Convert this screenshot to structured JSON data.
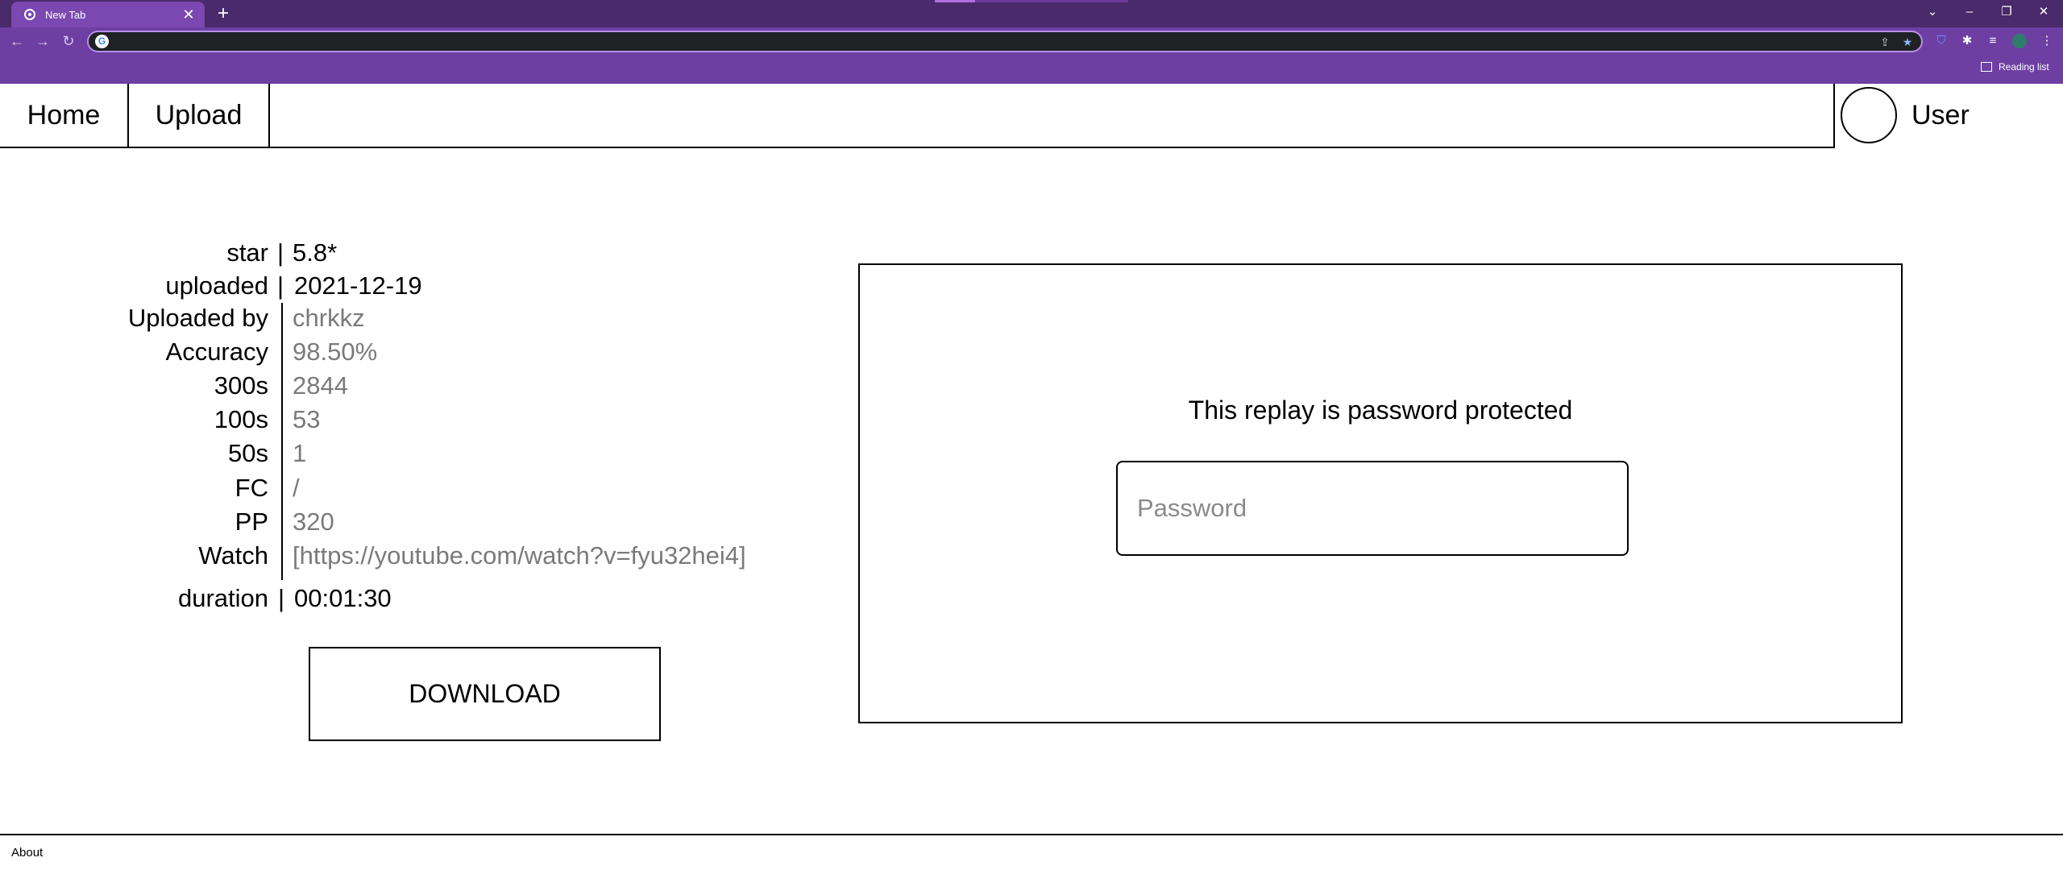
{
  "browser": {
    "tab_title": "New Tab",
    "tab_close": "✕",
    "new_tab": "+",
    "back": "←",
    "forward": "→",
    "reload": "↻",
    "google_g": "G",
    "reading_list": "Reading list",
    "window_controls": {
      "dropdown": "⌄",
      "minimize": "–",
      "restore": "❐",
      "close": "✕"
    },
    "colors": {
      "tabstrip": "#4a2a6a",
      "toolbar": "#6d3fa3",
      "active_tab": "#7a48b0",
      "omnibox": "#202124"
    }
  },
  "nav": {
    "home": "Home",
    "upload": "Upload",
    "user": "User"
  },
  "replay_info": {
    "star_label": "star",
    "star_value": "5.8*",
    "uploaded_label": "uploaded",
    "uploaded_value": "2021-12-19",
    "uploaded_by_label": "Uploaded by",
    "uploaded_by_value": "chrkkz",
    "accuracy_label": "Accuracy",
    "accuracy_value": "98.50%",
    "c300_label": "300s",
    "c300_value": "2844",
    "c100_label": "100s",
    "c100_value": "53",
    "c50_label": "50s",
    "c50_value": "1",
    "fc_label": "FC",
    "fc_value": "/",
    "pp_label": "PP",
    "pp_value": "320",
    "watch_label": "Watch",
    "watch_value": "[https://youtube.com/watch?v=fyu32hei4]",
    "duration_label": "duration",
    "duration_value": "00:01:30",
    "separator": "|"
  },
  "download_label": "DOWNLOAD",
  "password_panel": {
    "message": "This replay is password protected",
    "placeholder": "Password",
    "value": ""
  },
  "footer": {
    "about": "About"
  }
}
